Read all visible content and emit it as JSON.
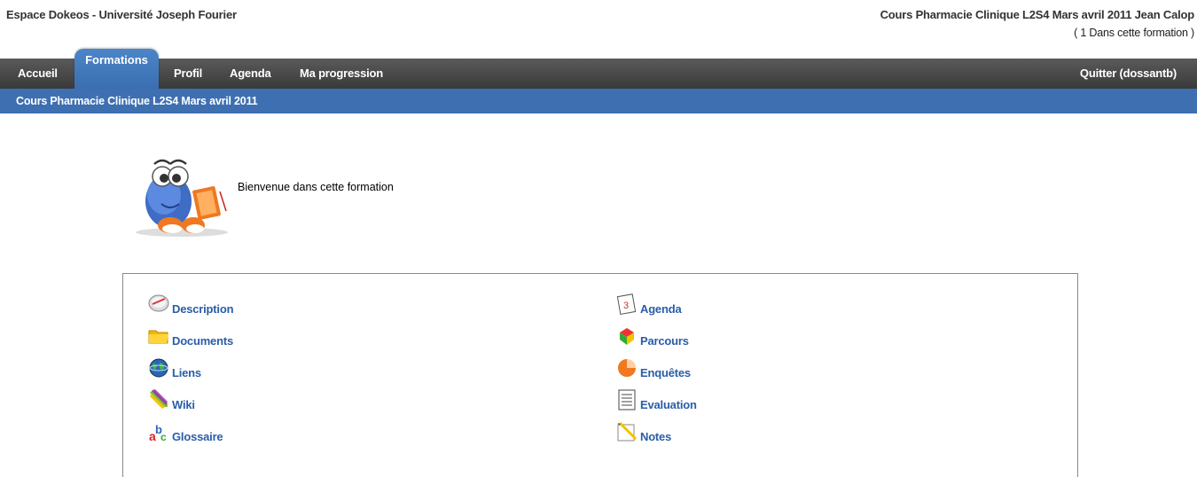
{
  "header": {
    "site_name": "Espace Dokeos - Université Joseph Fourier",
    "course_line": "Cours Pharmacie Clinique L2S4 Mars avril 2011 Jean Calop",
    "count_line": "( 1 Dans cette formation )"
  },
  "nav": {
    "items": [
      "Accueil",
      "Formations",
      "Profil",
      "Agenda",
      "Ma progression"
    ],
    "active": "Formations",
    "logout": "Quitter (dossantb)"
  },
  "breadcrumb": "Cours Pharmacie Clinique L2S4 Mars avril 2011",
  "welcome": "Bienvenue dans cette formation",
  "tools": {
    "left": [
      {
        "label": "Description",
        "icon": "description-icon"
      },
      {
        "label": "Documents",
        "icon": "folder-icon"
      },
      {
        "label": "Liens",
        "icon": "globe-icon"
      },
      {
        "label": "Wiki",
        "icon": "pencils-icon"
      },
      {
        "label": "Glossaire",
        "icon": "glossary-icon"
      }
    ],
    "right": [
      {
        "label": "Agenda",
        "icon": "calendar-icon"
      },
      {
        "label": "Parcours",
        "icon": "learning-path-icon"
      },
      {
        "label": "Enquêtes",
        "icon": "survey-icon"
      },
      {
        "label": "Evaluation",
        "icon": "evaluation-icon"
      },
      {
        "label": "Notes",
        "icon": "notes-icon"
      }
    ]
  },
  "colors": {
    "nav_bg": "#464646",
    "active_tab": "#3e6fb1",
    "link": "#2a5da8"
  }
}
